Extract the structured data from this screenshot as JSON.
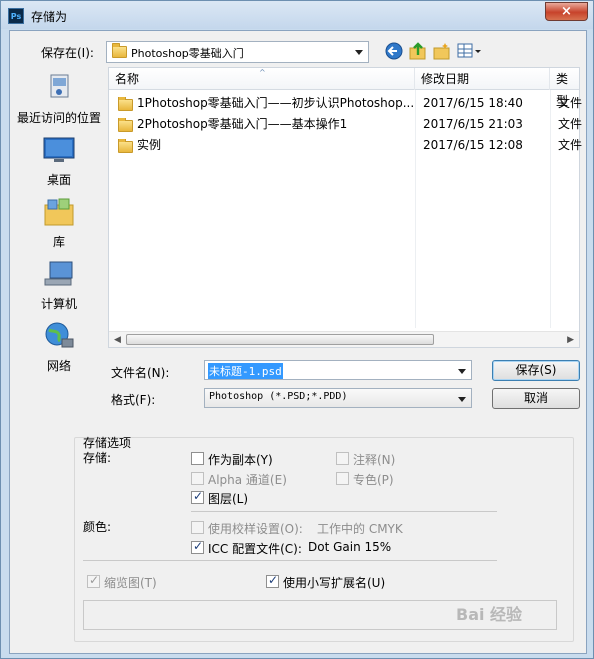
{
  "window": {
    "title": "存储为",
    "app_icon": "Ps",
    "close_glyph": "×"
  },
  "toolbar": {
    "save_in_label": "保存在(I):",
    "save_in_value": "Photoshop零基础入门"
  },
  "places": [
    {
      "label": "最近访问的位置",
      "icon": "recent-places-icon"
    },
    {
      "label": "桌面",
      "icon": "desktop-icon"
    },
    {
      "label": "库",
      "icon": "libraries-icon"
    },
    {
      "label": "计算机",
      "icon": "computer-icon"
    },
    {
      "label": "网络",
      "icon": "network-icon"
    }
  ],
  "filelist": {
    "columns": [
      "名称",
      "修改日期",
      "类型"
    ],
    "rows": [
      {
        "name": "1Photoshop零基础入门——初步认识Photoshop...",
        "date": "2017/6/15 18:40",
        "type": "文件"
      },
      {
        "name": "2Photoshop零基础入门——基本操作1",
        "date": "2017/6/15 21:03",
        "type": "文件"
      },
      {
        "name": "实例",
        "date": "2017/6/15 12:08",
        "type": "文件"
      }
    ]
  },
  "form": {
    "filename_label": "文件名(N):",
    "filename_value": "未标题-1.psd",
    "format_label": "格式(F):",
    "format_value": "Photoshop (*.PSD;*.PDD)",
    "save_button": "保存(S)",
    "cancel_button": "取消"
  },
  "options": {
    "section_title": "存储选项",
    "save_label": "存储:",
    "as_copy": {
      "label": "作为副本(Y)",
      "checked": false,
      "enabled": true
    },
    "notes": {
      "label": "注释(N)",
      "checked": false,
      "enabled": false
    },
    "alpha": {
      "label": "Alpha 通道(E)",
      "checked": false,
      "enabled": false
    },
    "spot": {
      "label": "专色(P)",
      "checked": false,
      "enabled": false
    },
    "layers": {
      "label": "图层(L)",
      "checked": true,
      "enabled": true
    },
    "color_label": "颜色:",
    "proof": {
      "label": "使用校样设置(O):",
      "suffix": "工作中的 CMYK",
      "checked": false,
      "enabled": false
    },
    "icc": {
      "label": "ICC 配置文件(C):",
      "suffix": "Dot Gain 15%",
      "checked": true,
      "enabled": true
    },
    "thumbnail": {
      "label": "缩览图(T)",
      "checked": true,
      "enabled": false
    },
    "lowercase": {
      "label": "使用小写扩展名(U)",
      "checked": true,
      "enabled": true
    }
  },
  "watermark": "Bai 经验",
  "colors": {
    "title_bar": "#c4d7ec",
    "close_button": "#c7432b",
    "selection": "#3399ff"
  }
}
